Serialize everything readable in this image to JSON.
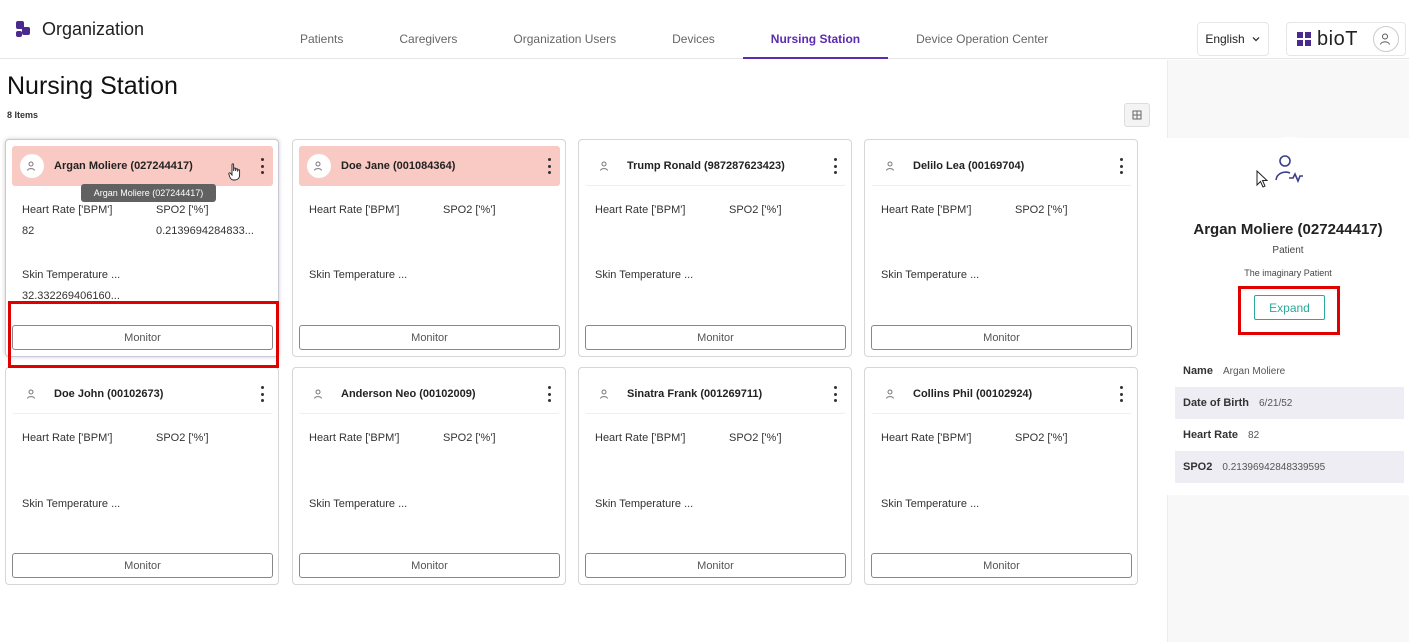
{
  "app": {
    "title": "Organization"
  },
  "nav": {
    "tabs": [
      {
        "label": "Patients"
      },
      {
        "label": "Caregivers"
      },
      {
        "label": "Organization Users"
      },
      {
        "label": "Devices"
      },
      {
        "label": "Nursing Station",
        "active": true
      },
      {
        "label": "Device Operation Center"
      }
    ]
  },
  "header": {
    "language": "English",
    "brand": "bioT"
  },
  "page": {
    "title": "Nursing Station",
    "count": "8 Items"
  },
  "labels": {
    "heart_rate": "Heart Rate ['BPM']",
    "spo2": "SPO2 ['%']",
    "skin_temp": "Skin Temperature ...",
    "monitor": "Monitor"
  },
  "cards": [
    {
      "name": "Argan Moliere (027244417)",
      "alert": true,
      "heart_rate": "82",
      "spo2": "0.2139694284833...",
      "skin_temp": "32.332269406160..."
    },
    {
      "name": "Doe Jane (001084364)",
      "alert": true,
      "heart_rate": "",
      "spo2": "",
      "skin_temp": ""
    },
    {
      "name": "Trump Ronald (987287623423)",
      "alert": false,
      "heart_rate": "",
      "spo2": "",
      "skin_temp": ""
    },
    {
      "name": "Delilo Lea (00169704)",
      "alert": false,
      "heart_rate": "",
      "spo2": "",
      "skin_temp": ""
    },
    {
      "name": "Doe John (00102673)",
      "alert": false,
      "heart_rate": "",
      "spo2": "",
      "skin_temp": ""
    },
    {
      "name": "Anderson Neo (00102009)",
      "alert": false,
      "heart_rate": "",
      "spo2": "",
      "skin_temp": ""
    },
    {
      "name": "Sinatra Frank (001269711)",
      "alert": false,
      "heart_rate": "",
      "spo2": "",
      "skin_temp": ""
    },
    {
      "name": "Collins Phil (00102924)",
      "alert": false,
      "heart_rate": "",
      "spo2": "",
      "skin_temp": ""
    }
  ],
  "tooltip": "Argan Moliere (027244417)",
  "side": {
    "name": "Argan Moliere (027244417)",
    "role": "Patient",
    "description": "The imaginary Patient",
    "expand": "Expand",
    "rows": [
      {
        "key": "Name",
        "value": "Argan Moliere"
      },
      {
        "key": "Date of Birth",
        "value": "6/21/52"
      },
      {
        "key": "Heart Rate",
        "value": "82"
      },
      {
        "key": "SPO2",
        "value": "0.21396942848339595"
      }
    ]
  },
  "colors": {
    "accent": "#5b2bb0",
    "alert": "#f9c9c3",
    "expand": "#2aa89a",
    "highlight": "#e00000"
  }
}
